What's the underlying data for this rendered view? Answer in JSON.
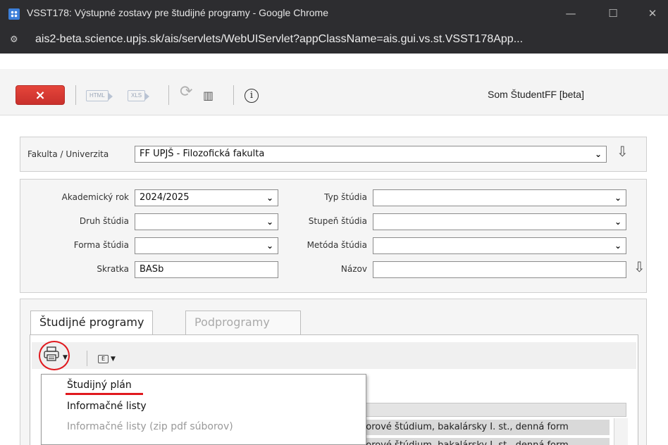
{
  "window": {
    "title": "VSST178: Výstupné zostavy pre študijné programy - Google Chrome",
    "minimize": "—",
    "maximize": "☐",
    "close": "✕"
  },
  "address_bar": {
    "url": "ais2-beta.science.upjs.sk/ais/servlets/WebUIServlet?appClassName=ais.gui.vs.st.VSST178App..."
  },
  "toolbar": {
    "close_label": "×",
    "html_label": "HTML",
    "xls_label": "XLS",
    "info_label": "i",
    "user_label": "Som ŠtudentFF [beta]"
  },
  "faculty": {
    "label": "Fakulta / Univerzita",
    "value": "FF UPJŠ - Filozofická fakulta"
  },
  "filters": {
    "akademicky_rok": {
      "label": "Akademický rok",
      "value": "2024/2025"
    },
    "druh_studia": {
      "label": "Druh štúdia",
      "value": ""
    },
    "forma_studia": {
      "label": "Forma štúdia",
      "value": ""
    },
    "skratka": {
      "label": "Skratka",
      "value": "BASb"
    },
    "typ_studia": {
      "label": "Typ štúdia",
      "value": ""
    },
    "stupen_studia": {
      "label": "Stupeň štúdia",
      "value": ""
    },
    "metoda_studia": {
      "label": "Metóda štúdia",
      "value": ""
    },
    "nazov": {
      "label": "Názov",
      "value": ""
    }
  },
  "tabs": [
    {
      "label": "Študijné programy",
      "active": true
    },
    {
      "label": "Podprogramy",
      "active": false
    }
  ],
  "table_rows": [
    "borové štúdium, bakalársky I. st., denná form",
    "borové štúdium, bakalársky I. st., denná form"
  ],
  "menu": {
    "items": [
      {
        "label": "Študijný plán",
        "enabled": true
      },
      {
        "label": "Informačné listy",
        "enabled": true
      },
      {
        "label": "Informačné listy (zip pdf súborov)",
        "enabled": false
      }
    ]
  },
  "colors": {
    "close_button": "#d9393a",
    "annotation_red": "#e0191e",
    "titlebar": "#2d2d30"
  }
}
